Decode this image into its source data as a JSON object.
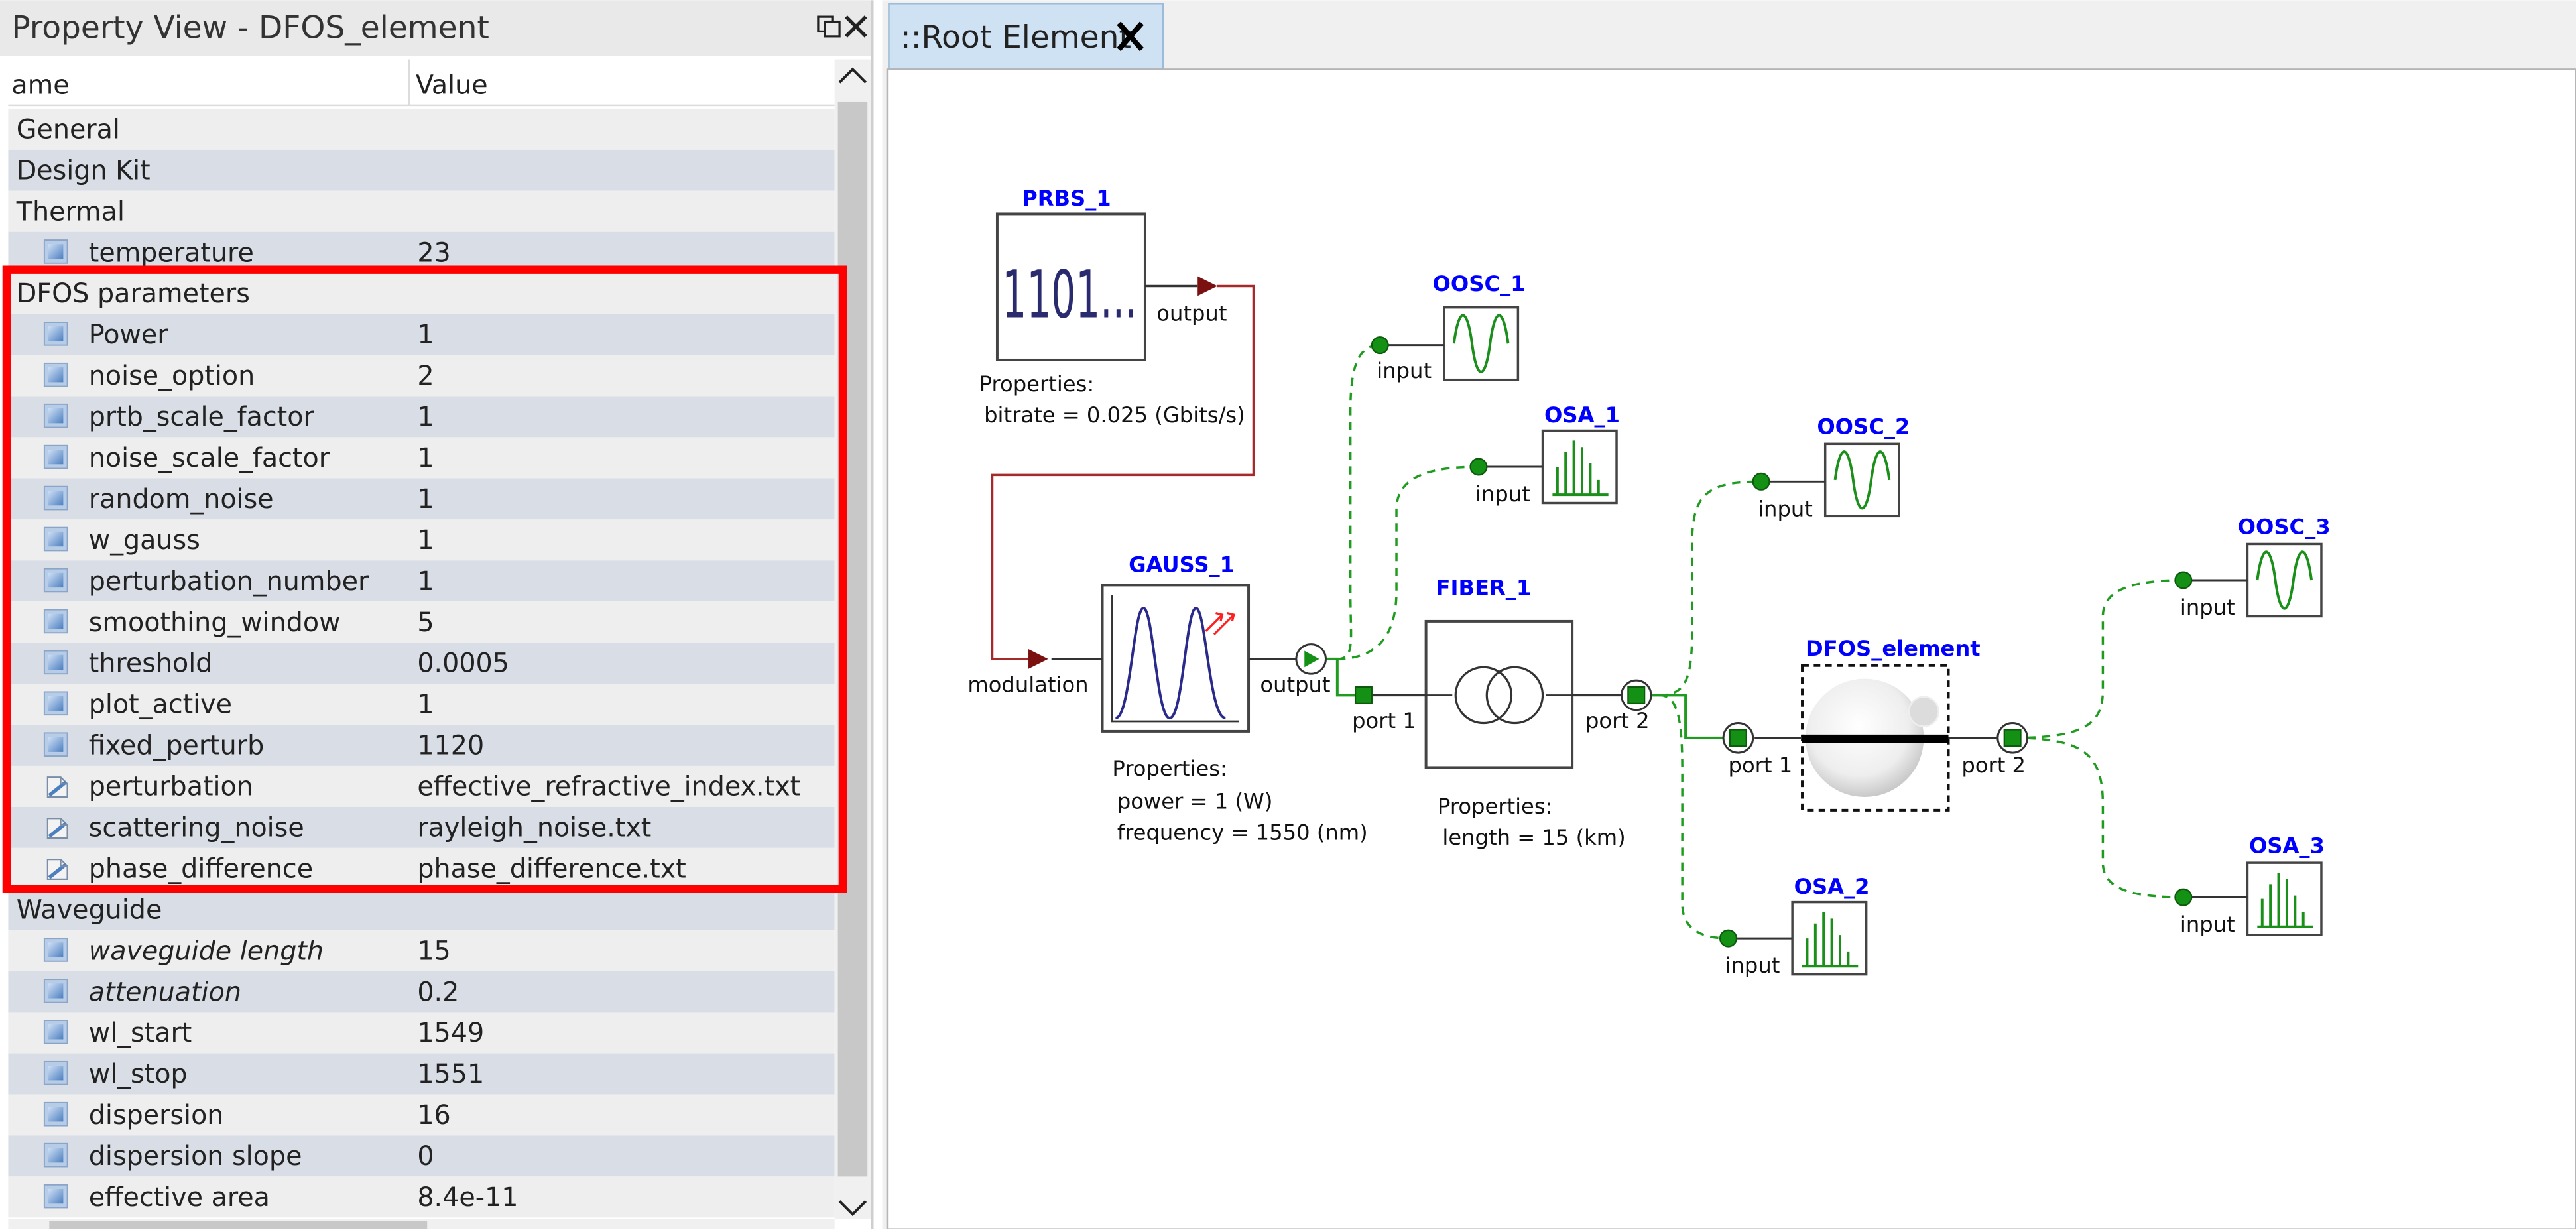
{
  "property_view": {
    "title": "Property View - DFOS_element",
    "col_name": "ame",
    "col_value": "Value",
    "rows": [
      {
        "type": "group",
        "label": "General"
      },
      {
        "type": "group",
        "label": "Design Kit"
      },
      {
        "type": "group",
        "label": "Thermal"
      },
      {
        "type": "prop",
        "icon": "square-icon",
        "label": "temperature",
        "value": "23"
      },
      {
        "type": "group",
        "label": "DFOS parameters"
      },
      {
        "type": "prop",
        "icon": "square-icon",
        "label": "Power",
        "value": "1"
      },
      {
        "type": "prop",
        "icon": "square-icon",
        "label": "noise_option",
        "value": "2"
      },
      {
        "type": "prop",
        "icon": "square-icon",
        "label": "prtb_scale_factor",
        "value": "1"
      },
      {
        "type": "prop",
        "icon": "square-icon",
        "label": "noise_scale_factor",
        "value": "1"
      },
      {
        "type": "prop",
        "icon": "square-icon",
        "label": "random_noise",
        "value": "1"
      },
      {
        "type": "prop",
        "icon": "square-icon",
        "label": "w_gauss",
        "value": "1"
      },
      {
        "type": "prop",
        "icon": "square-icon",
        "label": "perturbation_number",
        "value": "1"
      },
      {
        "type": "prop",
        "icon": "square-icon",
        "label": "smoothing_window",
        "value": "5"
      },
      {
        "type": "prop",
        "icon": "square-icon",
        "label": "threshold",
        "value": "0.0005"
      },
      {
        "type": "prop",
        "icon": "square-icon",
        "label": "plot_active",
        "value": "1"
      },
      {
        "type": "prop",
        "icon": "square-icon",
        "label": "fixed_perturb",
        "value": "1120"
      },
      {
        "type": "prop",
        "icon": "file-icon",
        "label": "perturbation",
        "value": "effective_refractive_index.txt"
      },
      {
        "type": "prop",
        "icon": "file-icon",
        "label": "scattering_noise",
        "value": "rayleigh_noise.txt"
      },
      {
        "type": "prop",
        "icon": "file-icon",
        "label": "phase_difference",
        "value": "phase_difference.txt"
      },
      {
        "type": "group",
        "label": "Waveguide"
      },
      {
        "type": "prop",
        "icon": "square-icon",
        "label": "waveguide length",
        "value": "15",
        "italic": true
      },
      {
        "type": "prop",
        "icon": "square-icon",
        "label": "attenuation",
        "value": "0.2",
        "italic": true
      },
      {
        "type": "prop",
        "icon": "square-icon",
        "label": "wl_start",
        "value": "1549"
      },
      {
        "type": "prop",
        "icon": "square-icon",
        "label": "wl_stop",
        "value": "1551"
      },
      {
        "type": "prop",
        "icon": "square-icon",
        "label": "dispersion",
        "value": "16"
      },
      {
        "type": "prop",
        "icon": "square-icon",
        "label": "dispersion slope",
        "value": "0"
      },
      {
        "type": "prop",
        "icon": "square-icon",
        "label": "effective area",
        "value": "8.4e-11"
      }
    ]
  },
  "editor_tab": {
    "label": "::Root Element"
  },
  "schematic": {
    "elements": {
      "prbs_1": {
        "name": "PRBS_1",
        "glyph": "1101...",
        "port": "output",
        "props_title": "Properties:",
        "props": [
          "bitrate = 0.025 (Gbits/s)"
        ]
      },
      "gauss_1": {
        "name": "GAUSS_1",
        "port_in": "modulation",
        "port_out": "output",
        "props_title": "Properties:",
        "props": [
          "power = 1 (W)",
          "frequency = 1550 (nm)"
        ]
      },
      "fiber_1": {
        "name": "FIBER_1",
        "port_in": "port 1",
        "port_out": "port 2",
        "props_title": "Properties:",
        "props": [
          "length = 15 (km)"
        ]
      },
      "dfos_element": {
        "name": "DFOS_element",
        "port_in": "port 1",
        "port_out": "port 2"
      },
      "oosc_1": {
        "name": "OOSC_1",
        "port": "input"
      },
      "osa_1": {
        "name": "OSA_1",
        "port": "input"
      },
      "oosc_2": {
        "name": "OOSC_2",
        "port": "input"
      },
      "osa_2": {
        "name": "OSA_2",
        "port": "input"
      },
      "oosc_3": {
        "name": "OOSC_3",
        "port": "input"
      },
      "osa_3": {
        "name": "OSA_3",
        "port": "input"
      }
    }
  },
  "colors": {
    "highlight_border": "#ff0000",
    "element_name": "#0000ff",
    "electrical_wire": "#a52a2a",
    "optical_wire": "#1f9c1f",
    "port_green": "#188a18",
    "row_light": "#eeeeee",
    "row_dark": "#d9dee6"
  }
}
